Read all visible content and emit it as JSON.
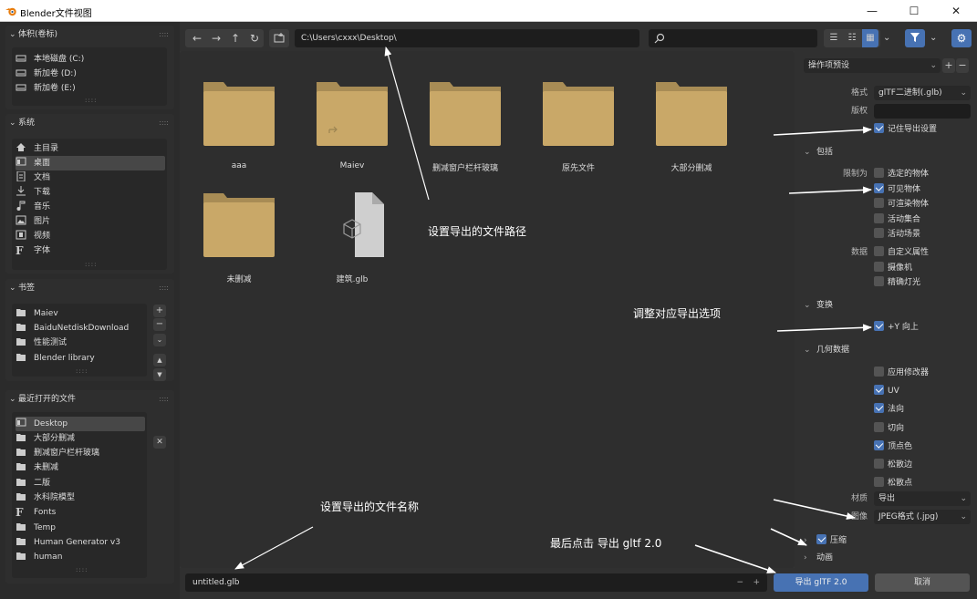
{
  "window": {
    "title": "Blender文件视图",
    "minimize": "—",
    "maximize": "☐",
    "close": "✕"
  },
  "left": {
    "volumes": {
      "title": "体积(卷标)",
      "items": [
        "本地磁盘 (C:)",
        "新加卷 (D:)",
        "新加卷 (E:)"
      ]
    },
    "system": {
      "title": "系统",
      "items": [
        "主目录",
        "桌面",
        "文档",
        "下载",
        "音乐",
        "图片",
        "视频",
        "字体"
      ],
      "selected": "桌面"
    },
    "bookmarks": {
      "title": "书签",
      "items": [
        "Maiev",
        "BaiduNetdiskDownload",
        "性能测试",
        "Blender library"
      ]
    },
    "recent": {
      "title": "最近打开的文件",
      "items": [
        "Desktop",
        "大部分删减",
        "删减窗户栏杆玻璃",
        "未删减",
        "二版",
        "水科院模型",
        "Fonts",
        "Temp",
        "Human Generator v3",
        "human"
      ],
      "selected": "Desktop"
    }
  },
  "toolbar": {
    "path": "C:\\Users\\cxxx\\Desktop\\",
    "search_placeholder": ""
  },
  "files": [
    {
      "name": "aaa",
      "type": "folder"
    },
    {
      "name": "Maiev",
      "type": "folder-link"
    },
    {
      "name": "删减窗户栏杆玻璃",
      "type": "folder"
    },
    {
      "name": "原先文件",
      "type": "folder"
    },
    {
      "name": "大部分删减",
      "type": "folder"
    },
    {
      "name": "未删减",
      "type": "folder"
    },
    {
      "name": "建筑.glb",
      "type": "file"
    }
  ],
  "right": {
    "preset": "操作项预设",
    "format_label": "格式",
    "format_value": "glTF二进制(.glb)",
    "copyright_label": "版权",
    "copyright_value": "",
    "remember": "记住导出设置",
    "include": {
      "title": "包括",
      "limit_label": "限制为",
      "limit": [
        {
          "label": "选定的物体",
          "checked": false
        },
        {
          "label": "可见物体",
          "checked": true
        },
        {
          "label": "可渲染物体",
          "checked": false
        },
        {
          "label": "活动集合",
          "checked": false
        },
        {
          "label": "活动场景",
          "checked": false
        }
      ],
      "data_label": "数据",
      "data": [
        {
          "label": "自定义属性",
          "checked": false
        },
        {
          "label": "摄像机",
          "checked": false
        },
        {
          "label": "精确灯光",
          "checked": false
        }
      ]
    },
    "transform": {
      "title": "变换",
      "yup": "+Y 向上",
      "checked": true
    },
    "geometry": {
      "title": "几何数据",
      "items": [
        {
          "label": "应用修改器",
          "checked": false
        },
        {
          "label": "UV",
          "checked": true
        },
        {
          "label": "法向",
          "checked": true
        },
        {
          "label": "切向",
          "checked": false
        },
        {
          "label": "顶点色",
          "checked": true
        },
        {
          "label": "松散边",
          "checked": false
        },
        {
          "label": "松散点",
          "checked": false
        }
      ],
      "material_label": "材质",
      "material_value": "导出",
      "image_label": "图像",
      "image_value": "JPEG格式 (.jpg)"
    },
    "compress": "压缩",
    "animation": "动画"
  },
  "bottom": {
    "filename": "untitled.glb",
    "export": "导出 glTF 2.0",
    "cancel": "取消"
  },
  "annotations": {
    "path": "设置导出的文件路径",
    "options": "调整对应导出选项",
    "filename": "设置导出的文件名称",
    "finally": "最后点击 导出 gltf 2.0"
  },
  "colors": {
    "folder": "#c9a868",
    "accent": "#4772b3",
    "bg": "#2b2b2b"
  }
}
